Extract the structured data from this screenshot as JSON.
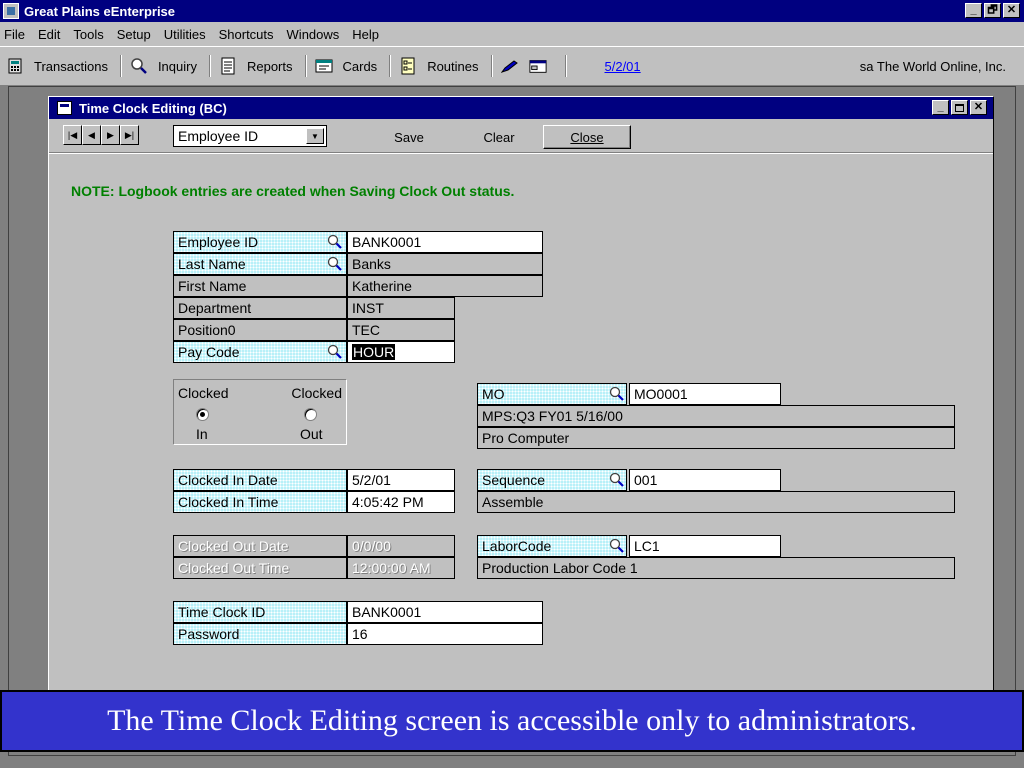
{
  "app": {
    "title": "Great Plains eEnterprise"
  },
  "window_buttons": {
    "minimize": "_",
    "restore": "🗗",
    "close": "✕"
  },
  "menu": [
    "File",
    "Edit",
    "Tools",
    "Setup",
    "Utilities",
    "Shortcuts",
    "Windows",
    "Help"
  ],
  "toolbar": {
    "transactions": "Transactions",
    "inquiry": "Inquiry",
    "reports": "Reports",
    "cards": "Cards",
    "routines": "Routines",
    "date": "5/2/01",
    "user": "sa  The World Online, Inc."
  },
  "window": {
    "title": "Time Clock  Editing (BC)",
    "browse_by": "Employee ID",
    "save": "Save",
    "clear": "Clear",
    "close": "Close"
  },
  "note": "NOTE: Logbook entries are created when Saving Clock Out status.",
  "employee": {
    "id_label": "Employee ID",
    "id_value": "BANK0001",
    "last_label": "Last Name",
    "last_value": "Banks",
    "first_label": "First Name",
    "first_value": "Katherine",
    "dept_label": "Department",
    "dept_value": "INST",
    "pos_label": "Position0",
    "pos_value": "TEC",
    "pay_label": "Pay Code",
    "pay_value": "HOUR"
  },
  "clock": {
    "clocked_in_top": "Clocked",
    "clocked_in_bottom": "In",
    "clocked_out_top": "Clocked",
    "clocked_out_bottom": "Out",
    "selected": "in"
  },
  "mo": {
    "label": "MO",
    "value": "MO0001",
    "line1": "MPS:Q3 FY01 5/16/00",
    "line2": "Pro Computer"
  },
  "clocked_in": {
    "date_label": "Clocked In Date",
    "date_value": "5/2/01",
    "time_label": "Clocked In Time",
    "time_value": "4:05:42 PM"
  },
  "sequence": {
    "label": "Sequence",
    "value": "001",
    "desc": "Assemble"
  },
  "clocked_out": {
    "date_label": "Clocked Out Date",
    "date_value": "0/0/00",
    "time_label": "Clocked Out Time",
    "time_value": "12:00:00 AM"
  },
  "labor": {
    "label": "LaborCode",
    "value": "LC1",
    "desc": "Production Labor Code 1"
  },
  "timeclock": {
    "id_label": "Time Clock ID",
    "id_value": "BANK0001",
    "pw_label": "Password",
    "pw_value": "16"
  },
  "caption": "The Time Clock Editing screen is accessible only to administrators.",
  "colors": {
    "title_bar": "#000080",
    "note": "#008000",
    "required_field": "#b8f0f8",
    "caption_bg": "#3333cc"
  }
}
